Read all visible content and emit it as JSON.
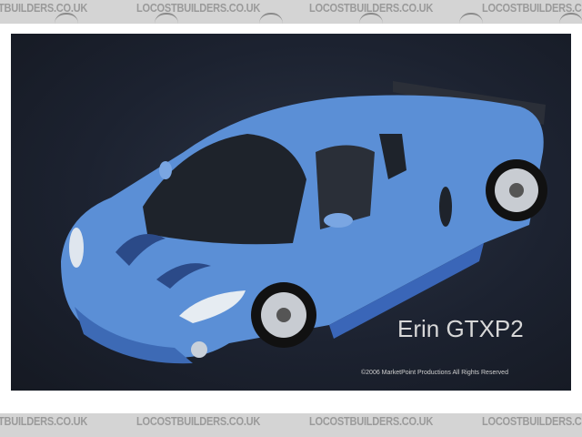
{
  "watermark": {
    "text": "LOCOSTBUILDERS.CO.UK"
  },
  "photo": {
    "title": "Erin GTXP2",
    "copyright": "©2006 MarketPoint Productions All Rights Reserved",
    "colors": {
      "car_body": "#5b8fd6",
      "background": "#1c2230"
    }
  }
}
